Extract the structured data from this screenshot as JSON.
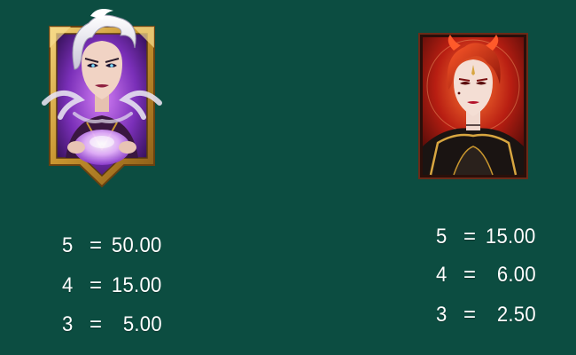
{
  "background_color": "#0c4d41",
  "symbols": [
    {
      "name": "sorceress",
      "icon": "sorceress-portrait-gold-frame-icon",
      "frame_color": "#c8952f",
      "accent_color": "#a14ad8",
      "paytable": [
        {
          "count": "5",
          "eq": "=",
          "value": "50.00"
        },
        {
          "count": "4",
          "eq": "=",
          "value": "15.00"
        },
        {
          "count": "3",
          "eq": "=",
          "value": "5.00"
        }
      ]
    },
    {
      "name": "red-queen",
      "icon": "red-queen-portrait-dark-frame-icon",
      "frame_color": "#3a1a14",
      "accent_color": "#c42a1a",
      "paytable": [
        {
          "count": "5",
          "eq": "=",
          "value": "15.00"
        },
        {
          "count": "4",
          "eq": "=",
          "value": "6.00"
        },
        {
          "count": "3",
          "eq": "=",
          "value": "2.50"
        }
      ]
    }
  ]
}
